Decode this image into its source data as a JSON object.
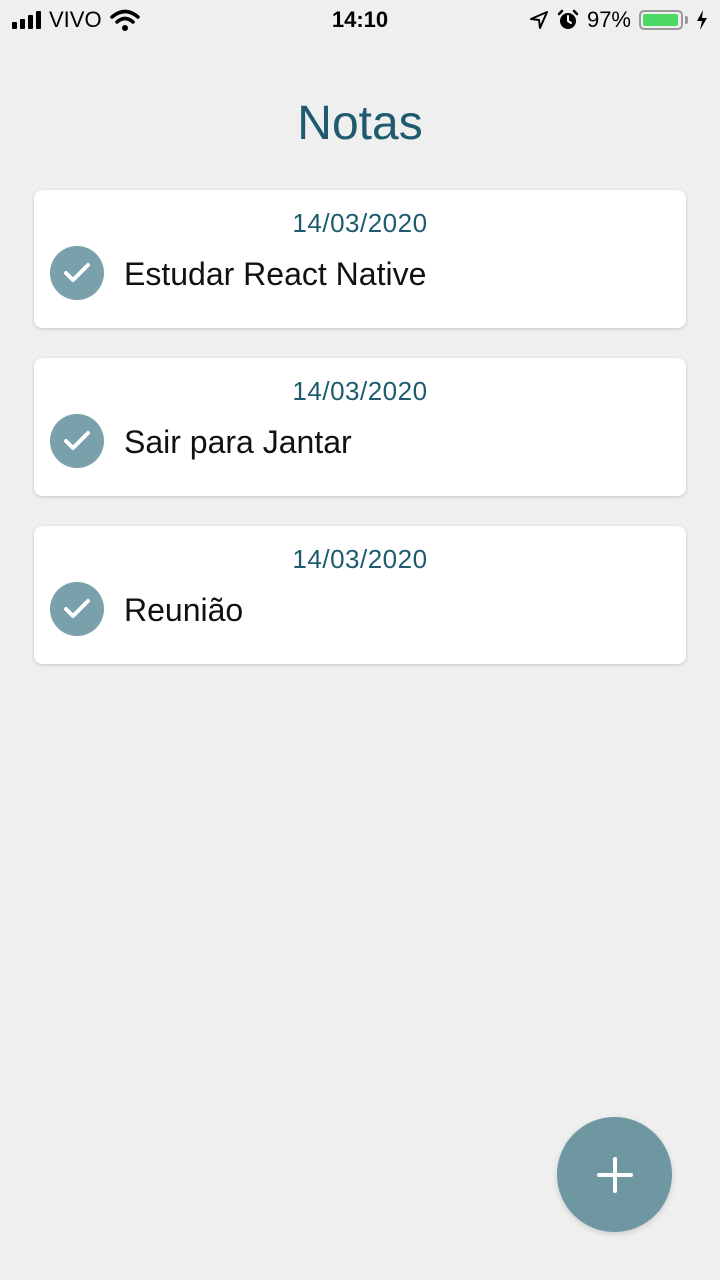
{
  "status_bar": {
    "carrier": "VIVO",
    "time": "14:10",
    "battery_percent": "97%",
    "battery_level": 0.97,
    "icons": [
      "signal-icon",
      "wifi-icon",
      "location-arrow-icon",
      "alarm-icon",
      "battery-icon",
      "charging-bolt-icon"
    ]
  },
  "header": {
    "title": "Notas"
  },
  "notes": [
    {
      "date": "14/03/2020",
      "text": "Estudar React Native",
      "icon": "check-icon"
    },
    {
      "date": "14/03/2020",
      "text": "Sair para Jantar",
      "icon": "check-icon"
    },
    {
      "date": "14/03/2020",
      "text": "Reunião",
      "icon": "check-icon"
    }
  ],
  "fab": {
    "icon": "plus-icon"
  },
  "colors": {
    "accent": "#1e5b6e",
    "check_circle": "#7aa0ab",
    "fab": "#6e97a2",
    "background": "#efefef",
    "battery": "#4cd964"
  }
}
